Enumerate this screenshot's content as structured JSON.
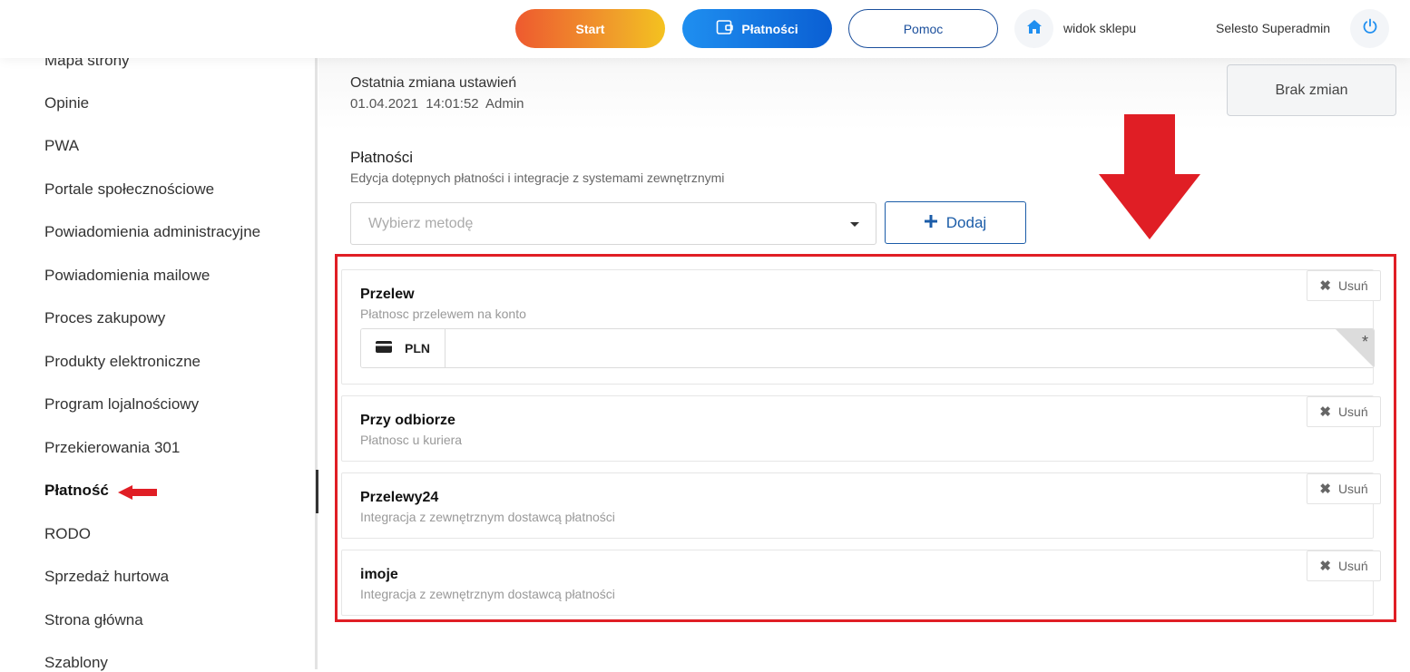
{
  "topbar": {
    "start_label": "Start",
    "payments_label": "Płatności",
    "help_label": "Pomoc",
    "shop_view_label": "widok sklepu",
    "user_name": "Selesto Superadmin",
    "colors": {
      "start_from": "#ee5a2f",
      "start_to": "#f4c21f",
      "payments_from": "#1f8ff0",
      "payments_to": "#0a5fd3",
      "help_border": "#1b4f9c",
      "home_icon": "#1f8ff0",
      "power_icon": "#1f8ff0"
    },
    "icons": {
      "payments": "wallet-icon",
      "home": "home-icon",
      "power": "power-icon"
    }
  },
  "sidebar": {
    "items": [
      {
        "label": "Mapa strony"
      },
      {
        "label": "Opinie"
      },
      {
        "label": "PWA"
      },
      {
        "label": "Portale społecznościowe"
      },
      {
        "label": "Powiadomienia administracyjne"
      },
      {
        "label": "Powiadomienia mailowe"
      },
      {
        "label": "Proces zakupowy"
      },
      {
        "label": "Produkty elektroniczne"
      },
      {
        "label": "Program lojalnościowy"
      },
      {
        "label": "Przekierowania 301"
      },
      {
        "label": "Płatność"
      },
      {
        "label": "RODO"
      },
      {
        "label": "Sprzedaż hurtowa"
      },
      {
        "label": "Strona główna"
      },
      {
        "label": "Szablony"
      }
    ],
    "active_item": "Płatność"
  },
  "header": {
    "last_change_title": "Ostatnia zmiana ustawień",
    "last_change_date": "01.04.2021",
    "last_change_time": "14:01:52",
    "last_change_user": "Admin",
    "no_changes_label": "Brak zmian"
  },
  "payments": {
    "title": "Płatności",
    "subtitle": "Edycja dotępnych płatności i integracje z systemami zewnętrznymi",
    "select_placeholder": "Wybierz metodę",
    "add_label": "Dodaj",
    "remove_label": "Usuń",
    "methods": [
      {
        "name": "Przelew",
        "description": "Płatnosc przelewem na konto",
        "currency": "PLN",
        "required_marker": "*"
      },
      {
        "name": "Przy odbiorze",
        "description": "Płatnosc u kuriera"
      },
      {
        "name": "Przelewy24",
        "description": "Integracja z zewnętrznym dostawcą płatności"
      },
      {
        "name": "imoje",
        "description": "Integracja z zewnętrznym dostawcą płatności"
      }
    ]
  },
  "annotations": {
    "highlight_color": "#e01e25"
  }
}
